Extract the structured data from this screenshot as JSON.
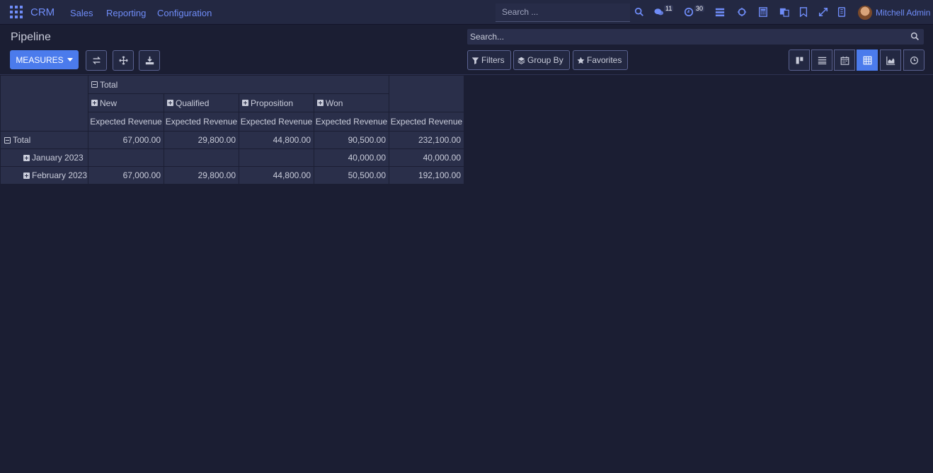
{
  "navbar": {
    "brand": "CRM",
    "menu": [
      "Sales",
      "Reporting",
      "Configuration"
    ],
    "search_placeholder": "Search ...",
    "messages_count": "11",
    "activities_count": "30",
    "user_name": "Mitchell Admin",
    "icons": [
      "apps-icon",
      "search-icon",
      "chat-icon",
      "clock-icon",
      "list-icon",
      "bug-icon",
      "calculator-icon",
      "language-icon",
      "bookmark-icon",
      "expand-icon",
      "mobile-icon"
    ]
  },
  "control_panel": {
    "title": "Pipeline",
    "search_placeholder": "Search...",
    "measures_label": "MEASURES",
    "filters_label": "Filters",
    "group_by_label": "Group By",
    "favorites_label": "Favorites",
    "views": [
      "kanban",
      "list",
      "calendar",
      "pivot",
      "graph",
      "activity"
    ],
    "active_view": "pivot"
  },
  "pivot": {
    "col_total_label": "Total",
    "columns": [
      "New",
      "Qualified",
      "Proposition",
      "Won"
    ],
    "measure_label": "Expected Revenue",
    "rows": [
      {
        "label": "Total",
        "values": [
          "67,000.00",
          "29,800.00",
          "44,800.00",
          "90,500.00",
          "232,100.00"
        ]
      },
      {
        "label": "January 2023",
        "values": [
          "",
          "",
          "",
          "40,000.00",
          "40,000.00"
        ]
      },
      {
        "label": "February 2023",
        "values": [
          "67,000.00",
          "29,800.00",
          "44,800.00",
          "50,500.00",
          "192,100.00"
        ]
      }
    ]
  },
  "colors": {
    "accent": "#4b7bec",
    "link": "#6f8cf7",
    "background": "#1b1e33",
    "cell": "#2a2f4a"
  }
}
